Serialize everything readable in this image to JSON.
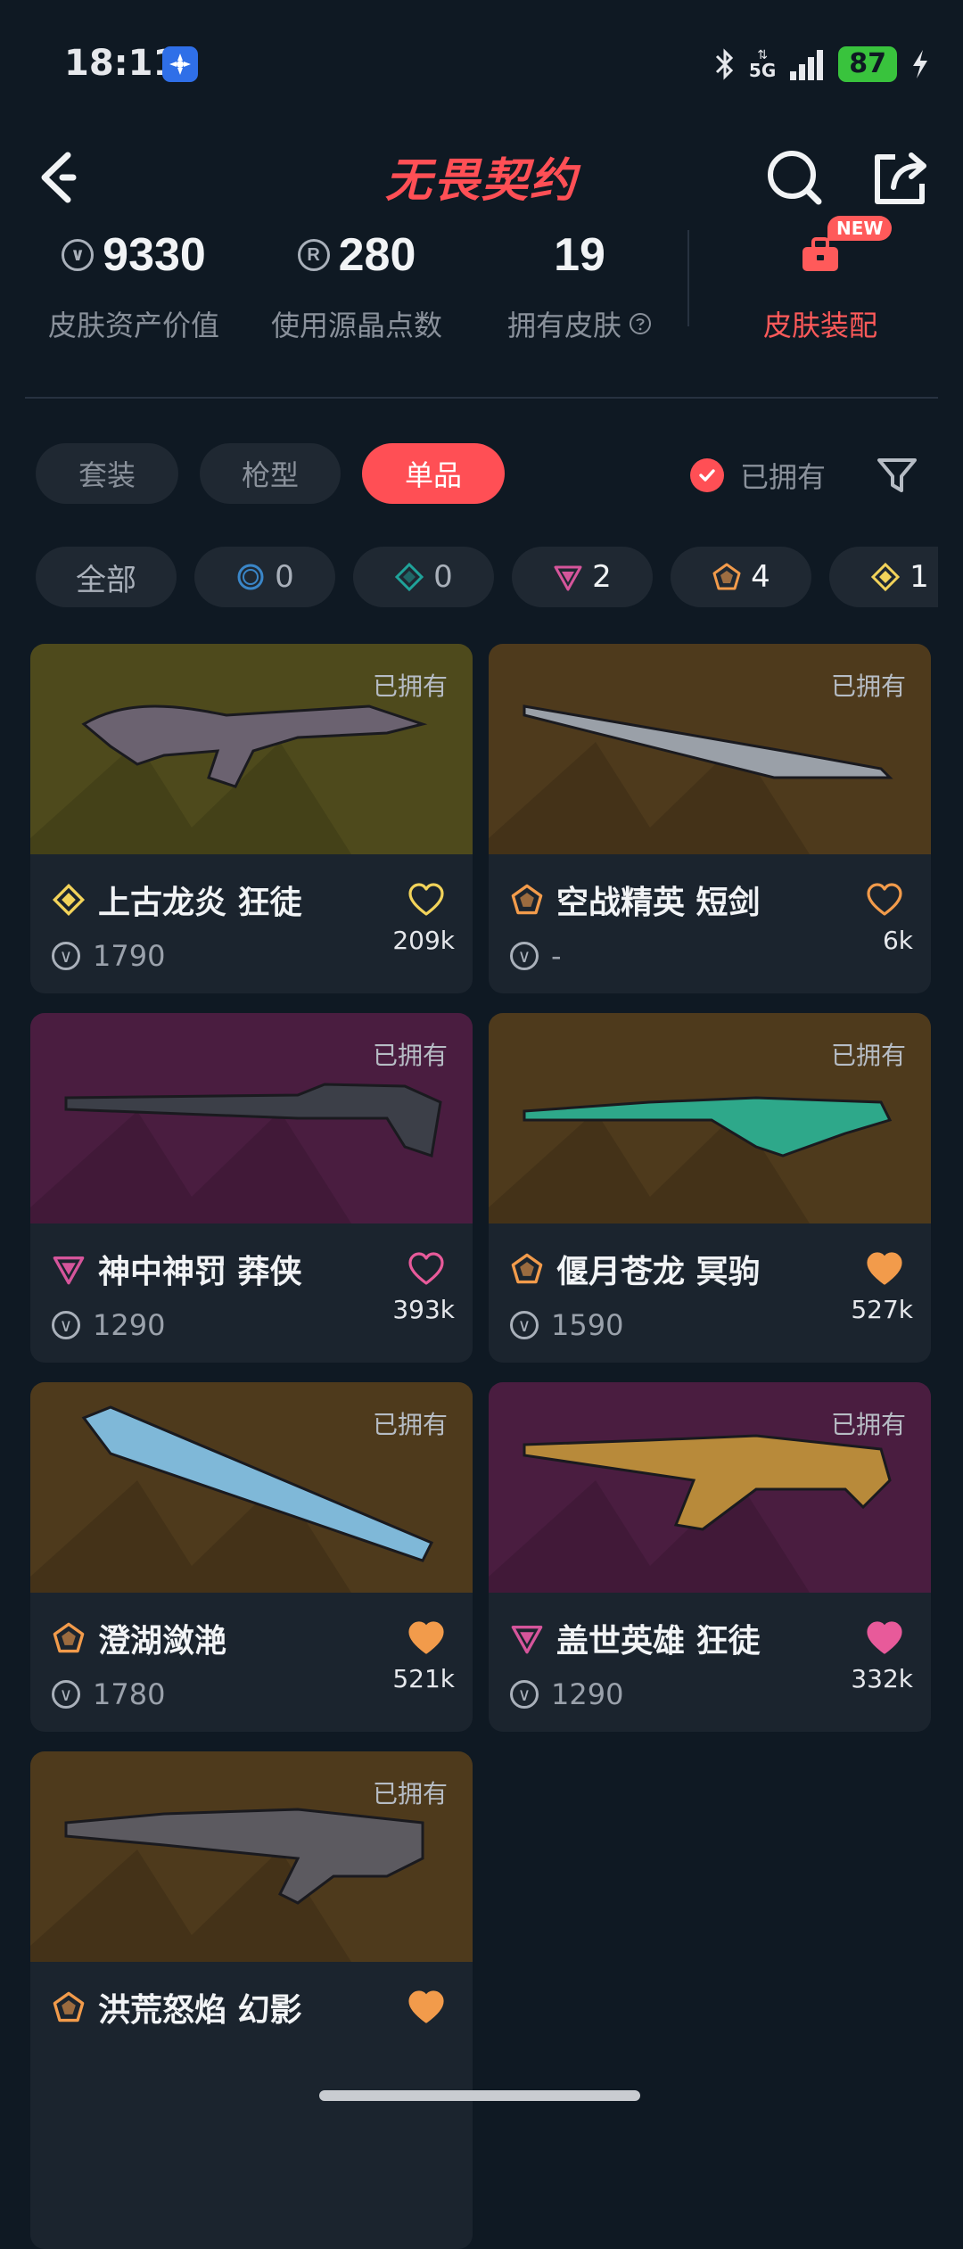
{
  "status_bar": {
    "time": "18:11",
    "network": "5G",
    "battery": "87"
  },
  "header": {
    "title": "无畏契约"
  },
  "stats": {
    "asset_value": {
      "value": "9330",
      "label": "皮肤资产价值"
    },
    "points_used": {
      "value": "280",
      "label": "使用源晶点数"
    },
    "owned_skins": {
      "value": "19",
      "label": "拥有皮肤"
    },
    "equip": {
      "label": "皮肤装配",
      "badge": "NEW"
    }
  },
  "tabs": [
    {
      "label": "套装",
      "active": false
    },
    {
      "label": "枪型",
      "active": false
    },
    {
      "label": "单品",
      "active": true
    }
  ],
  "owned_filter": {
    "label": "已拥有",
    "checked": true
  },
  "chips": [
    {
      "label": "全部"
    },
    {
      "count": "0",
      "icon": "select-tier-icon",
      "color": "#3a86c8"
    },
    {
      "count": "0",
      "icon": "deluxe-tier-icon",
      "color": "#1fa39a"
    },
    {
      "count": "2",
      "icon": "premium-tier-icon",
      "color": "#d5559b"
    },
    {
      "count": "4",
      "icon": "exclusive-tier-icon",
      "color": "#f29b4b"
    },
    {
      "count": "1",
      "icon": "ultra-tier-icon",
      "color": "#f2d35a"
    }
  ],
  "cards": [
    {
      "name": "上古龙炎 狂徒",
      "price": "1790",
      "likes": "209k",
      "owned": "已拥有",
      "tier": "ultra",
      "liked": false,
      "bg": "#4e4a1c"
    },
    {
      "name": "空战精英 短剑",
      "price": "-",
      "likes": "6k",
      "owned": "已拥有",
      "tier": "exclusive",
      "liked": false,
      "bg": "#4e3a1c"
    },
    {
      "name": "神中神罚 莽侠",
      "price": "1290",
      "likes": "393k",
      "owned": "已拥有",
      "tier": "premium",
      "liked": false,
      "bg": "#4a1d40"
    },
    {
      "name": "偃月苍龙 冥驹",
      "price": "1590",
      "likes": "527k",
      "owned": "已拥有",
      "tier": "exclusive",
      "liked": true,
      "bg": "#4e3a1c"
    },
    {
      "name": "澄湖潋滟",
      "price": "1780",
      "likes": "521k",
      "owned": "已拥有",
      "tier": "exclusive",
      "liked": true,
      "bg": "#4e3a1c"
    },
    {
      "name": "盖世英雄 狂徒",
      "price": "1290",
      "likes": "332k",
      "owned": "已拥有",
      "tier": "premium",
      "liked": true,
      "bg": "#4a1d40"
    },
    {
      "name": "洪荒怒焰 幻影",
      "price": "",
      "likes": "",
      "owned": "已拥有",
      "tier": "exclusive",
      "liked": true,
      "bg": "#4e3a1c"
    }
  ],
  "colors": {
    "accent": "#ff4f55",
    "background": "#0f1923",
    "card": "#1b242e",
    "heart_exclusive": "#f29b4b",
    "heart_premium": "#e85a9a"
  }
}
